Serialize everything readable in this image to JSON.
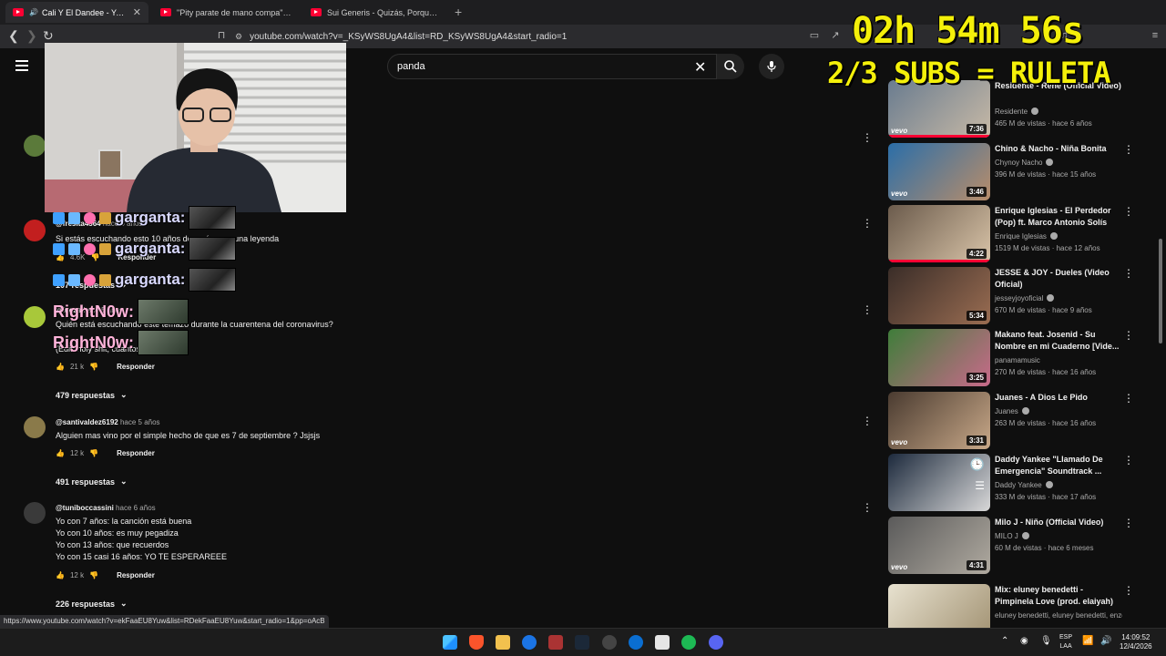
{
  "browser": {
    "tabs": [
      {
        "title": "Cali Y El Dandee - Yo Te Esperaré",
        "active": true
      },
      {
        "title": "\"Pity parate de mano compa\" - YouTube",
        "active": false
      },
      {
        "title": "Sui Generis - Quizás, Porque (Official",
        "active": false
      }
    ],
    "url": "youtube.com/watch?v=_KSyWS8UgA4&list=RD_KSyWS8UgA4&start_radio=1",
    "status_url": "https://www.youtube.com/watch?v=ekFaaEU8Yuw&list=RDekFaaEU8Yuw&start_radio=1&pp=oAcB"
  },
  "overlay": {
    "timer": "02h 54m 56s",
    "subs": "2/3 SUBS = RULETA",
    "emote_word": "garganta:",
    "emote_word2": "RightN0w:"
  },
  "search": {
    "value": "panda"
  },
  "comments": [
    {
      "author": "@fresita4564",
      "time": "hace 5 años",
      "lines": [
        "Si estás escuchando esto 10 años después eres una leyenda"
      ],
      "likes": "4.6K",
      "reply": "Responder",
      "replies": "107 respuestas"
    },
    {
      "author": "@lucas",
      "time": "hace 5 años",
      "lines": [
        "Quién está escuchando este temazo durante la cuarentena del coronavirus?",
        "(Edit: holy shit, cuantos likes 😃)"
      ],
      "likes": "21 k",
      "reply": "Responder",
      "replies": "479 respuestas"
    },
    {
      "author": "@santivaldez6192",
      "time": "hace 5 años",
      "lines": [
        "Alguien mas vino por el simple hecho de que es 7 de septiembre ? Jsjsjs"
      ],
      "likes": "12 k",
      "reply": "Responder",
      "replies": "491 respuestas"
    },
    {
      "author": "@tuniboccassini",
      "time": "hace 6 años",
      "lines": [
        "Yo con 7 años: la canción está buena",
        "Yo con 10 años: es muy pegadiza",
        "Yo con 13 años: que recuerdos",
        "Yo con 15 casi 16 años: YO TE ESPERAREEE"
      ],
      "likes": "12 k",
      "reply": "Responder",
      "replies": "226 respuestas"
    }
  ],
  "sidebar": [
    {
      "title": "Residente - René (Official Video)",
      "channel": "Residente",
      "stats": "465 M de vistas · hace 6 años",
      "duration": "7:36",
      "vevo": true,
      "colors": [
        "#6a7c8f",
        "#c7b9a6"
      ]
    },
    {
      "title": "Chino & Nacho - Niña Bonita",
      "channel": "Chynoy Nacho",
      "stats": "396 M de vistas · hace 15 años",
      "duration": "3:46",
      "vevo": true,
      "colors": [
        "#2b6ea8",
        "#b88d6a"
      ]
    },
    {
      "title": "Enrique Iglesias - El Perdedor (Pop) ft. Marco Antonio Solís",
      "channel": "Enrique Iglesias",
      "stats": "1519 M de vistas · hace 12 años",
      "duration": "4:22",
      "vevo": false,
      "colors": [
        "#6b5b4c",
        "#d9c4a8"
      ]
    },
    {
      "title": "JESSE & JOY - Dueles (Video Oficial)",
      "channel": "jesseyjoyoficial",
      "stats": "670 M de vistas · hace 9 años",
      "duration": "5:34",
      "vevo": false,
      "colors": [
        "#3a2d28",
        "#9a6d52"
      ]
    },
    {
      "title": "Makano feat. Josenid - Su Nombre en mi Cuaderno [Vide...",
      "channel": "panamamusic",
      "stats": "270 M de vistas · hace 16 años",
      "duration": "3:25",
      "vevo": false,
      "colors": [
        "#3f7d3a",
        "#c86a8a"
      ]
    },
    {
      "title": "Juanes - A Dios Le Pido",
      "channel": "Juanes",
      "stats": "263 M de vistas · hace 16 años",
      "duration": "3:31",
      "vevo": true,
      "colors": [
        "#4a3b30",
        "#c8a888"
      ]
    },
    {
      "title": "Daddy Yankee \"Llamado De Emergencia\" Soundtrack ...",
      "channel": "Daddy Yankee",
      "stats": "333 M de vistas · hace 17 años",
      "duration": "",
      "vevo": false,
      "colors": [
        "#1d2a3d",
        "#d8d8d8"
      ]
    },
    {
      "title": "Milo J - Niño (Official Video)",
      "channel": "MILO J",
      "stats": "60 M de vistas · hace 6 meses",
      "duration": "4:31",
      "vevo": true,
      "colors": [
        "#5a5a5a",
        "#b0aaa0"
      ]
    },
    {
      "title": "Mix: eluney benedetti - Pimpinela Love (prod. elaiyah)",
      "channel": "eluney benedetti, eluney benedetti, enzoc...",
      "stats": "",
      "duration": "",
      "vevo": false,
      "colors": [
        "#e8e2d0",
        "#a09070"
      ]
    }
  ],
  "taskbar": {
    "lang": "ESP",
    "lang2": "LAA",
    "time": "14:09:52",
    "date": "12/4/2026"
  }
}
